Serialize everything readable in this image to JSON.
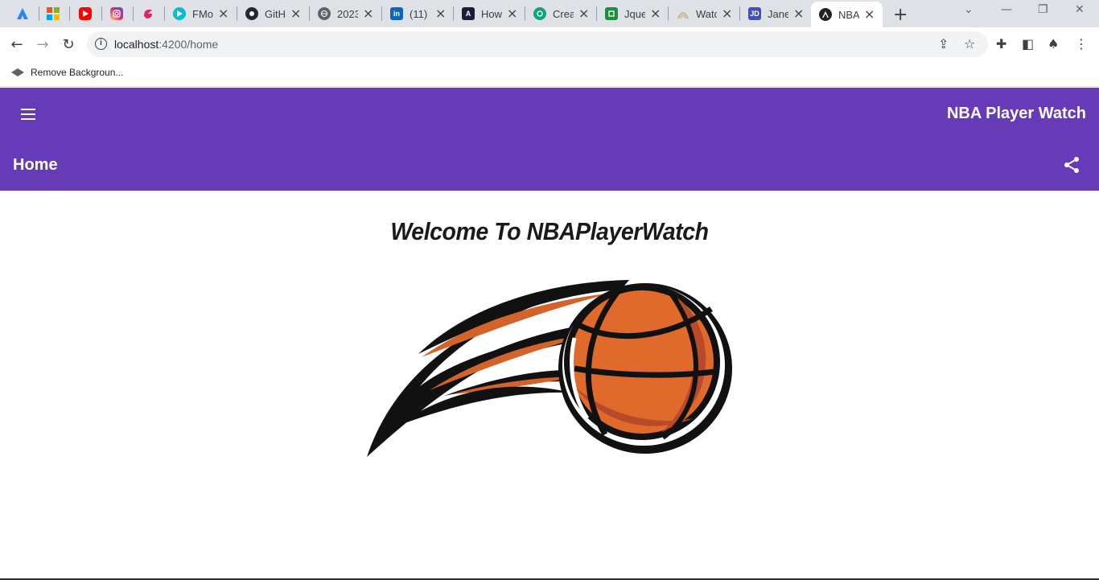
{
  "browser": {
    "tabs": [
      {
        "title": "",
        "icon": "atlassian-icon",
        "color": "#2684ff"
      },
      {
        "title": "",
        "icon": "microsoft-icon",
        "color": "#f25022"
      },
      {
        "title": "",
        "icon": "youtube-icon",
        "color": "#ff0000"
      },
      {
        "title": "",
        "icon": "instagram-icon",
        "color": "#d62976"
      },
      {
        "title": "",
        "icon": "app-icon",
        "color": "#e0245e"
      },
      {
        "title": "FMo",
        "icon": "play-icon",
        "color": "#00bcd4"
      },
      {
        "title": "GitH",
        "icon": "github-icon",
        "color": "#24292f"
      },
      {
        "title": "2023",
        "icon": "globe-icon",
        "color": "#5f6368"
      },
      {
        "title": "(11)",
        "icon": "linkedin-icon",
        "color": "#0a66c2"
      },
      {
        "title": "How",
        "icon": "ai-icon",
        "color": "#1b1b3a"
      },
      {
        "title": "Crea",
        "icon": "openai-icon",
        "color": "#10a37f"
      },
      {
        "title": "Jque",
        "icon": "sheet-icon",
        "color": "#1e8e3e"
      },
      {
        "title": "Watc",
        "icon": "logo-icon",
        "color": "#c9b48a"
      },
      {
        "title": "Jane",
        "icon": "jd-icon",
        "color": "#3f51b5"
      },
      {
        "title": "NBA",
        "icon": "angular-icon",
        "color": "#222222"
      }
    ],
    "url_host": "localhost",
    "url_path": ":4200/home",
    "bookmark": "Remove Backgroun..."
  },
  "app": {
    "title": "NBA Player Watch",
    "page_title": "Home",
    "welcome": "Welcome To NBAPlayerWatch",
    "primary_color": "#673ab7"
  }
}
